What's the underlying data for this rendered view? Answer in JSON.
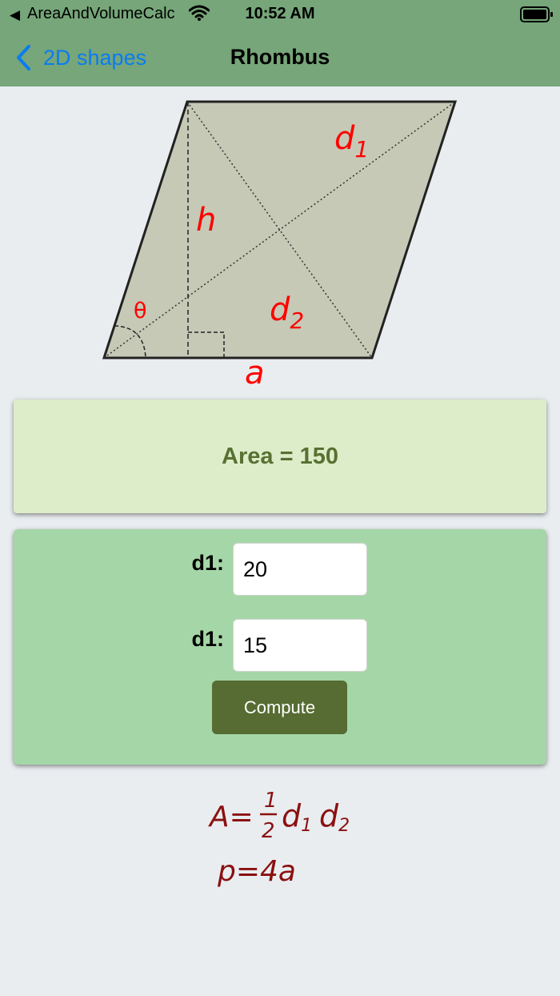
{
  "status_bar": {
    "back_app": "AreaAndVolumeCalc",
    "time": "10:52 AM"
  },
  "nav": {
    "back_label": "2D shapes",
    "title": "Rhombus"
  },
  "figure": {
    "labels": {
      "d1_main": "d",
      "d1_sub": "1",
      "d2_main": "d",
      "d2_sub": "2",
      "h": "h",
      "a": "a",
      "theta": "θ"
    }
  },
  "result": {
    "text": "Area = 150"
  },
  "form": {
    "field1_label": "d1:",
    "field1_value": "20",
    "field2_label": "d1:",
    "field2_value": "15",
    "compute_label": "Compute"
  },
  "formula": {
    "area_lhs": "A=",
    "frac_num": "1",
    "frac_den": "2",
    "d1_main": "d",
    "d1_sub": "1",
    "d2_main": "d",
    "d2_sub": "2",
    "perimeter": "p=4a"
  },
  "colors": {
    "header": "#76a679",
    "back_link": "#0a7cf0",
    "result_bg": "#deedc9",
    "result_text": "#577132",
    "form_bg": "#a5d6a7",
    "button_bg": "#566c32",
    "shape_fill": "#c5c9b6",
    "label_red": "#ff0000",
    "formula_red": "#8b1010"
  },
  "icons": [
    "back-arrow-icon",
    "wifi-icon",
    "battery-icon",
    "chevron-left-icon"
  ]
}
